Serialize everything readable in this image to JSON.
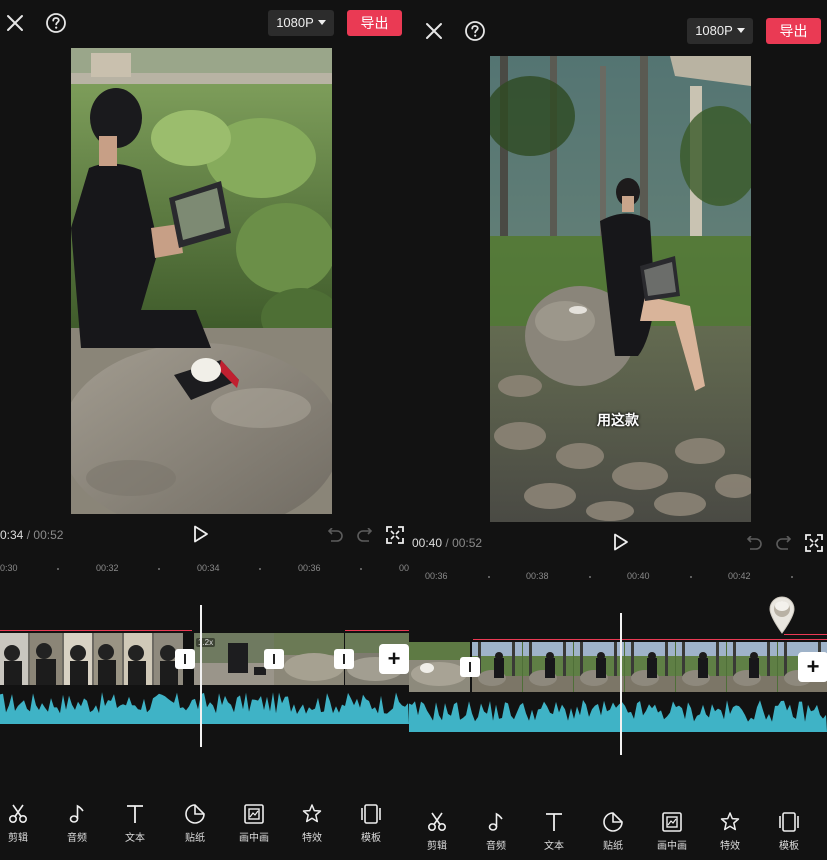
{
  "left": {
    "resolution": "1080P",
    "export_label": "导出",
    "time_current": "0:34",
    "time_sep": "/",
    "time_total": "00:52",
    "ruler_ticks": [
      "0:30",
      "00:32",
      "00:34",
      "00:36",
      "00"
    ],
    "speed_badge": "1.2x"
  },
  "right": {
    "resolution": "1080P",
    "export_label": "导出",
    "time_current": "00:40",
    "time_sep": "/",
    "time_total": "00:52",
    "ruler_ticks": [
      "00:36",
      "00:38",
      "00:40",
      "00:42"
    ],
    "caption": "用这款"
  },
  "toolbar": [
    "剪辑",
    "音频",
    "文本",
    "贴纸",
    "画中画",
    "特效",
    "模板"
  ],
  "icons": {
    "close": "close-icon",
    "help": "help-icon",
    "play": "play-icon",
    "undo": "undo-icon",
    "redo": "redo-icon",
    "fullscreen": "fullscreen-icon",
    "add": "add-clip-icon",
    "transition": "transition-icon",
    "tools": [
      "scissors-icon",
      "music-note-icon",
      "text-icon",
      "sticker-icon",
      "picture-in-picture-icon",
      "effects-icon",
      "template-icon"
    ]
  },
  "colors": {
    "accent": "#ea3a54",
    "audio_wave": "#3fb3c6",
    "background": "#121212"
  }
}
